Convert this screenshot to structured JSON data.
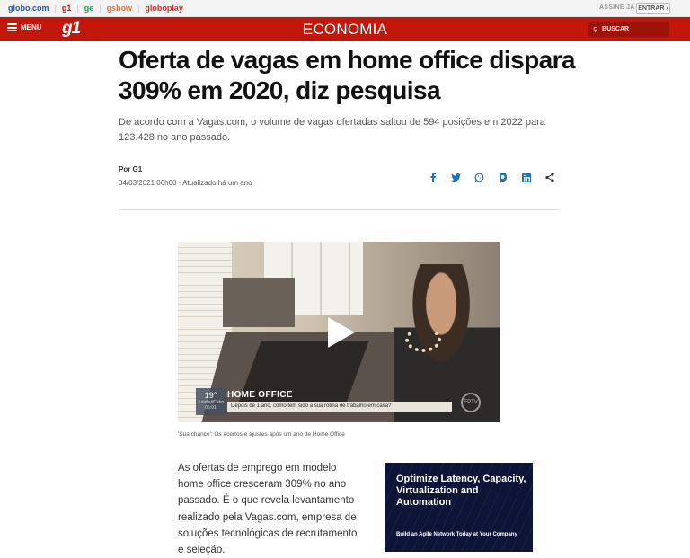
{
  "topbar": {
    "links": [
      {
        "label": "globo.com",
        "color": "#1a56b8"
      },
      {
        "label": "g1",
        "color": "#c4170c"
      },
      {
        "label": "ge",
        "color": "#06aa48"
      },
      {
        "label": "gshow",
        "color": "#f26a24"
      },
      {
        "label": "globoplay",
        "color": "#e0251b"
      }
    ],
    "assine": "ASSINE JÁ",
    "entrar": "ENTRAR",
    "entrar_chevron": "›"
  },
  "header": {
    "menu_label": "MENU",
    "logo": "g1",
    "section": "ECONOMIA",
    "search_label": "BUSCAR",
    "search_icon": "⚲",
    "accent": "#c4170c"
  },
  "article": {
    "title": "Oferta de vagas em home office dispara 309% em 2020, diz pesquisa",
    "subtitle": "De acordo com a Vagas.com, o volume de vagas ofertadas saltou de 594 posições em 2022 para 123.428 no ano passado.",
    "byline": "Por G1",
    "dateline": "04/03/2021 06h00 · Atualizado há um ano",
    "share_icons": [
      "facebook-icon",
      "twitter-icon",
      "whatsapp-icon",
      "messenger-icon",
      "linkedin-icon",
      "share-icon"
    ],
    "video": {
      "temperature": "19°",
      "temperature_sub": "Jundiaí/Cabo",
      "time": "06:01",
      "lower_third_title": "HOME OFFICE",
      "lower_third_caption": "Depois de 1 ano, como tem sido a sua rotina de trabalho em casa?",
      "badge": "EPTV"
    },
    "video_caption": "'Sua chance': Os acertos e ajustes após um ano de Home Office",
    "body": "As ofertas de emprego em modelo home office cresceram 309% no ano passado. É o que revela levantamento realizado pela Vagas.com, empresa de soluções tecnológicas de recrutamento e seleção."
  },
  "ad": {
    "headline": "Optimize Latency, Capacity, Virtualization and Automation",
    "subline": "Build an Agile Network Today at Your Company"
  }
}
